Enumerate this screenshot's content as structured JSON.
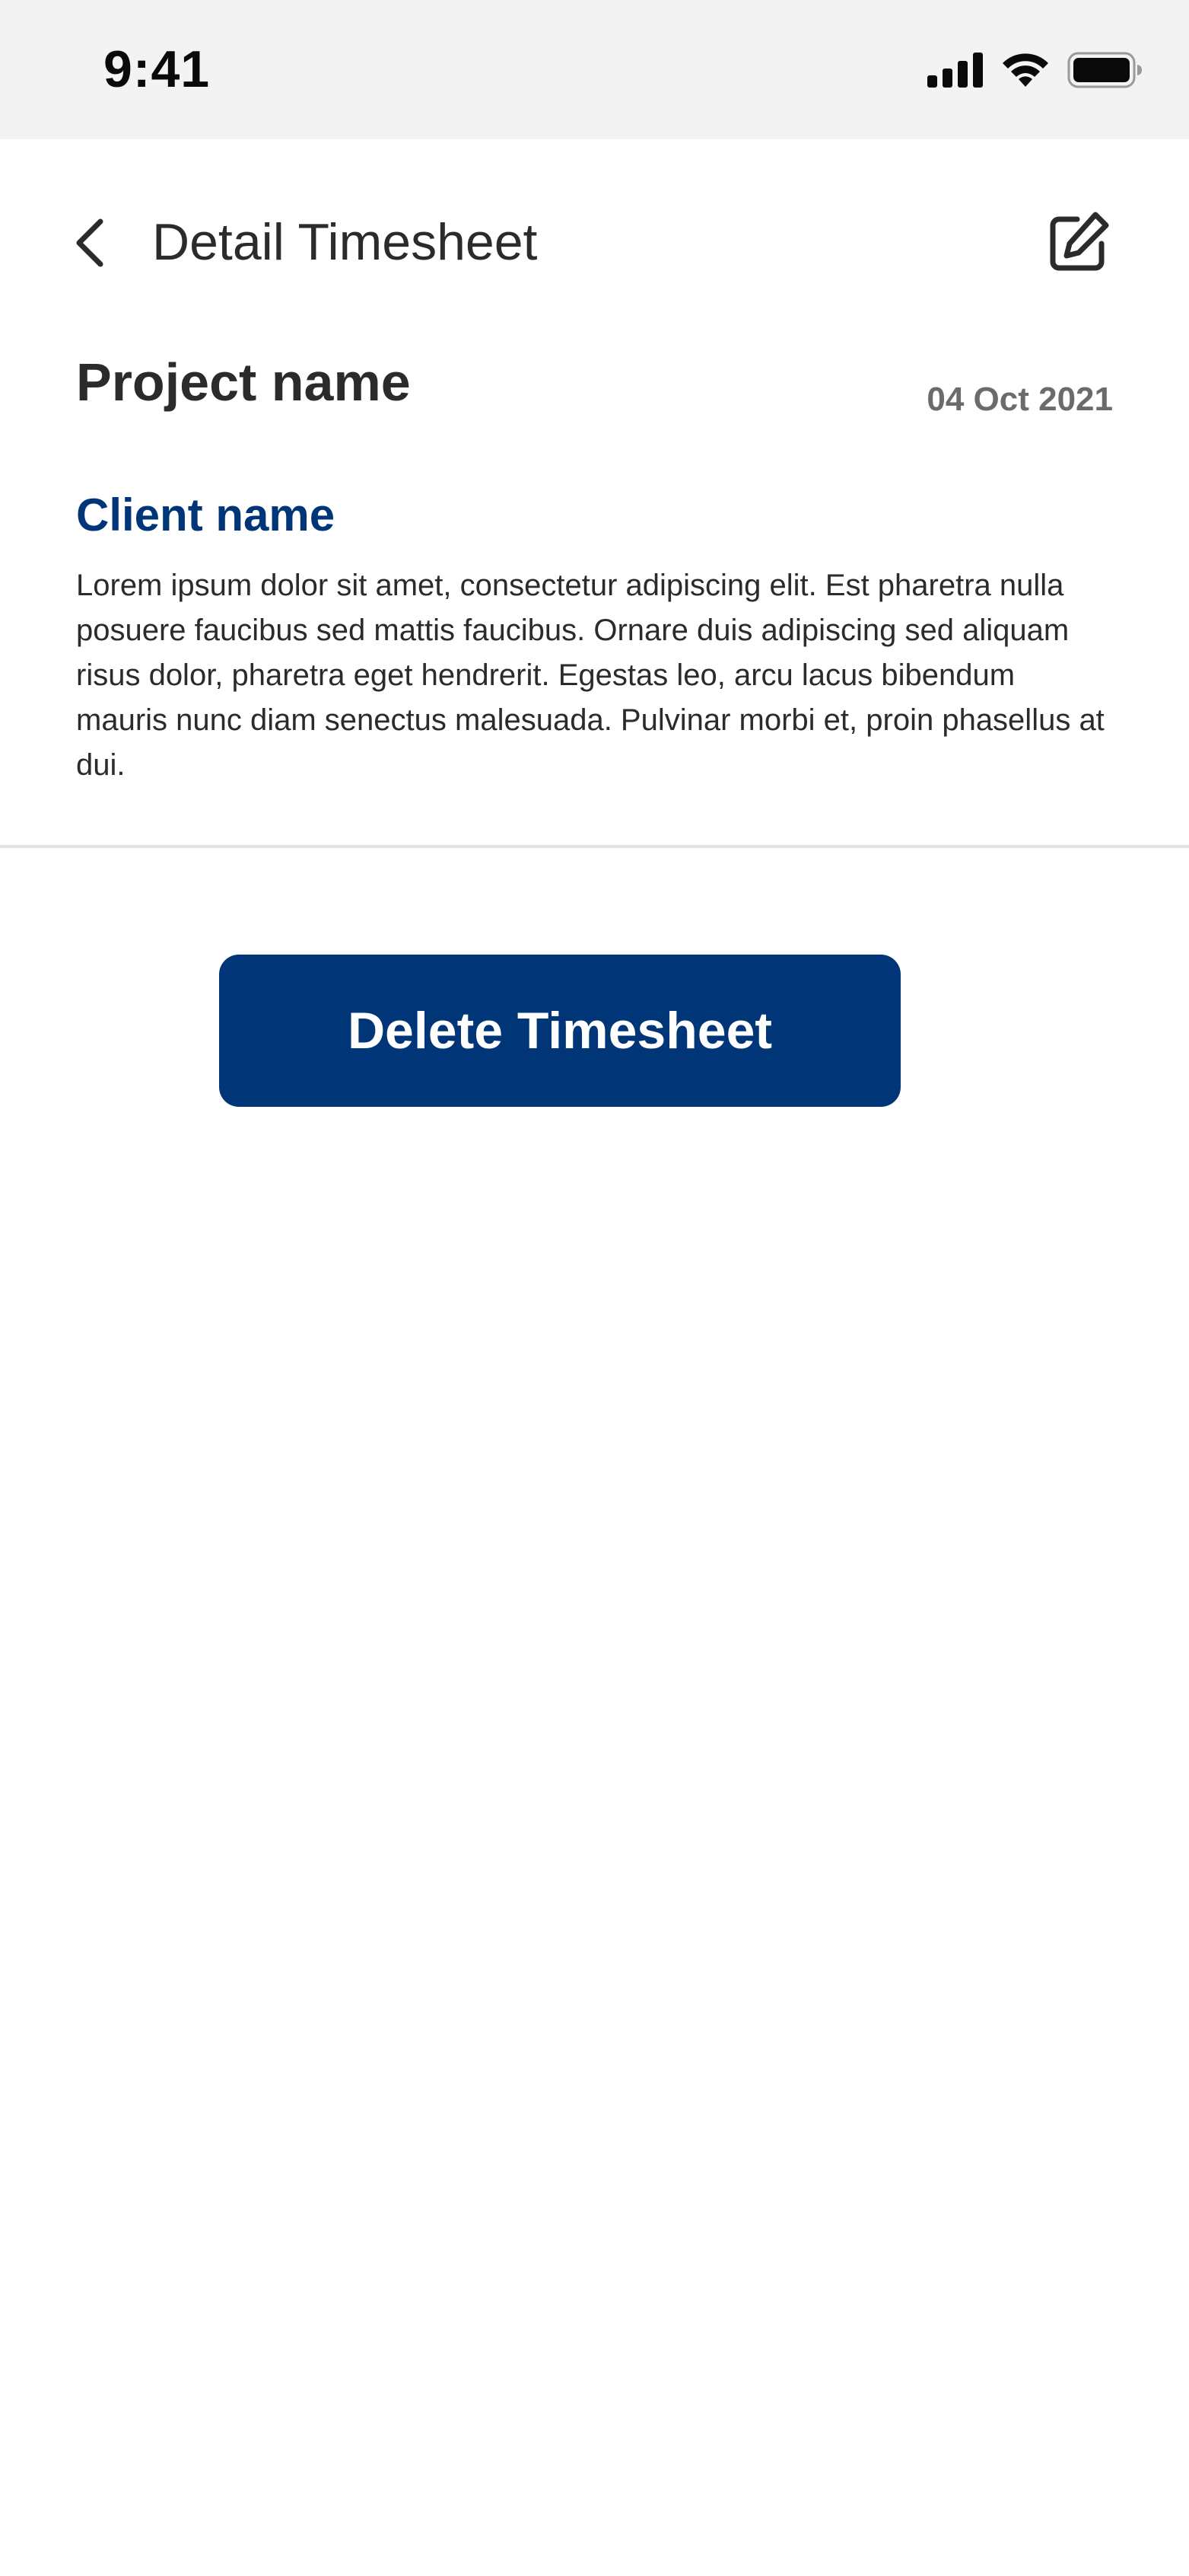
{
  "status_bar": {
    "time": "9:41",
    "icons": [
      "cellular-signal-icon",
      "wifi-icon",
      "battery-icon"
    ]
  },
  "header": {
    "title": "Detail Timesheet",
    "back_icon": "chevron-left-icon",
    "edit_icon": "edit-icon"
  },
  "timesheet": {
    "project_name": "Project name",
    "date": "04 Oct 2021",
    "client_name": "Client name",
    "description": "Lorem ipsum dolor sit amet, consectetur adipiscing elit. Est pharetra nulla posuere faucibus sed mattis faucibus. Ornare duis adipiscing sed aliquam risus dolor, pharetra eget hendrerit. Egestas leo, arcu lacus bibendum mauris nunc diam senectus malesuada. Pulvinar morbi et, proin phasellus at dui."
  },
  "actions": {
    "delete_label": "Delete Timesheet"
  },
  "colors": {
    "accent": "#003577",
    "status_bar_bg": "#f3f3f3",
    "text_primary": "#2b2b2b",
    "text_secondary": "#6b6b6b",
    "divider": "#e2e2e2"
  }
}
